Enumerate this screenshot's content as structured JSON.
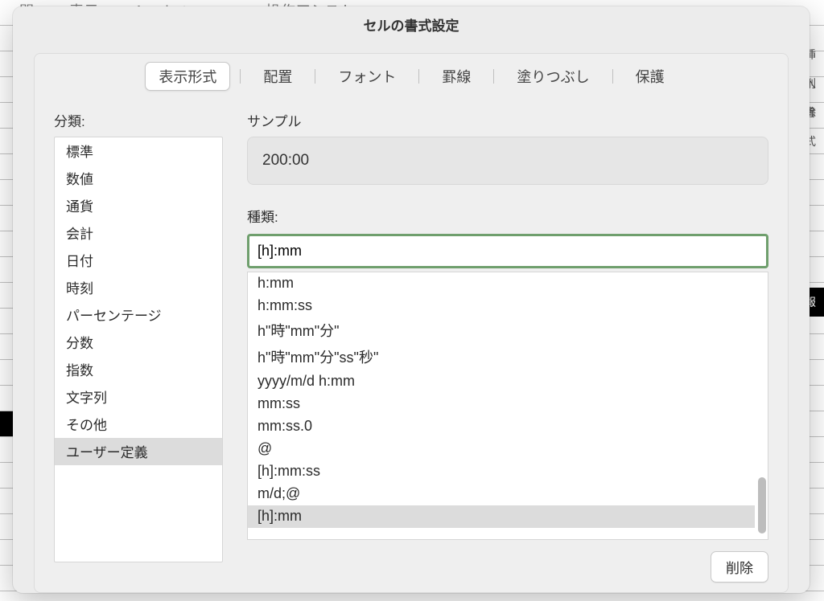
{
  "bg_menu": {
    "items": [
      "閲",
      "表示",
      "Acrobat",
      "操作アシスト"
    ],
    "icon": "○"
  },
  "dialog": {
    "title": "セルの書式設定",
    "tabs": [
      {
        "id": "number",
        "label": "表示形式"
      },
      {
        "id": "align",
        "label": "配置"
      },
      {
        "id": "font",
        "label": "フォント"
      },
      {
        "id": "border",
        "label": "罫線"
      },
      {
        "id": "fill",
        "label": "塗りつぶし"
      },
      {
        "id": "protect",
        "label": "保護"
      }
    ],
    "active_tab": "number",
    "category_label": "分類:",
    "categories": [
      "標準",
      "数値",
      "通貨",
      "会計",
      "日付",
      "時刻",
      "パーセンテージ",
      "分数",
      "指数",
      "文字列",
      "その他",
      "ユーザー定義"
    ],
    "selected_category_index": 11,
    "sample_label": "サンプル",
    "sample_value": "200:00",
    "type_label": "種類:",
    "type_input_value": "[h]:mm",
    "type_items": [
      "h:mm",
      "h:mm:ss",
      "h\"時\"mm\"分\"",
      "h\"時\"mm\"分\"ss\"秒\"",
      "yyyy/m/d h:mm",
      "mm:ss",
      "mm:ss.0",
      "@",
      "[h]:mm:ss",
      "m/d;@",
      "[h]:mm"
    ],
    "selected_type_index": 10,
    "delete_button": "削除"
  },
  "right_hints": [
    "挿入",
    "削除",
    "書式",
    "",
    "報"
  ]
}
